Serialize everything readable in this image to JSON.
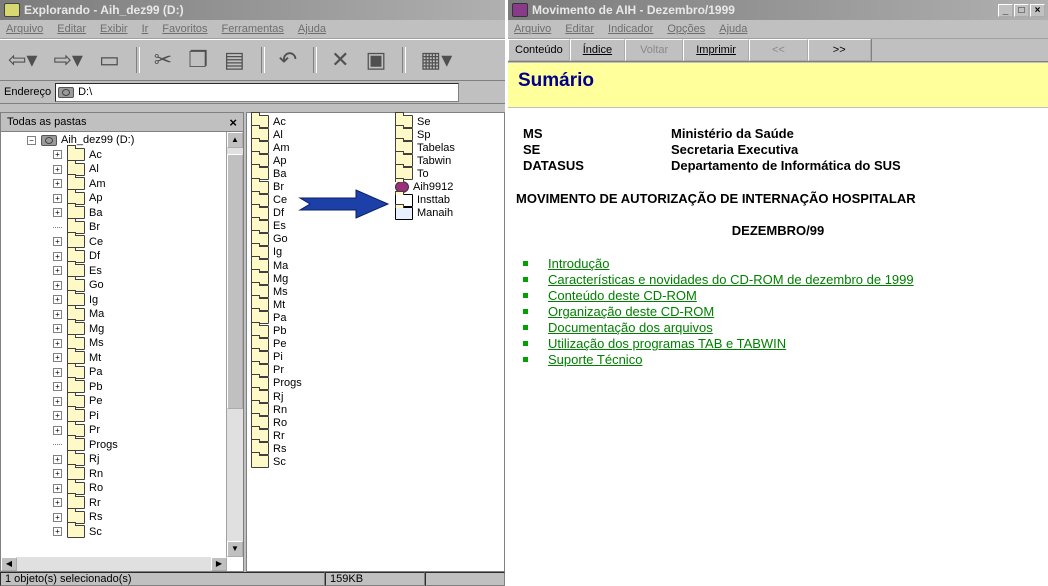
{
  "explorer": {
    "title": "Explorando - Aih_dez99 (D:)",
    "menu": [
      "Arquivo",
      "Editar",
      "Exibir",
      "Ir",
      "Favoritos",
      "Ferramentas",
      "Ajuda"
    ],
    "address_label": "Endereço",
    "address_value": "D:\\",
    "tree_header": "Todas as pastas",
    "tree_close": "×",
    "root": "Aih_dez99 (D:)",
    "tree_items": [
      "Ac",
      "Al",
      "Am",
      "Ap",
      "Ba",
      "Br",
      "Ce",
      "Df",
      "Es",
      "Go",
      "Ig",
      "Ma",
      "Mg",
      "Ms",
      "Mt",
      "Pa",
      "Pb",
      "Pe",
      "Pi",
      "Pr",
      "Progs",
      "Rj",
      "Rn",
      "Ro",
      "Rr",
      "Rs",
      "Sc"
    ],
    "list_col1": [
      "Ac",
      "Al",
      "Am",
      "Ap",
      "Ba",
      "Br",
      "Ce",
      "Df",
      "Es",
      "Go",
      "Ig",
      "Ma",
      "Mg",
      "Ms",
      "Mt",
      "Pa",
      "Pb",
      "Pe",
      "Pi",
      "Pr",
      "Progs",
      "Rj",
      "Rn",
      "Ro",
      "Rr",
      "Rs",
      "Sc"
    ],
    "list_col2_folders": [
      "Se",
      "Sp",
      "Tabelas",
      "Tabwin",
      "To"
    ],
    "list_col2_files": [
      "Aih9912",
      "Insttab",
      "Manaih"
    ],
    "status_left": "1 objeto(s) selecionado(s)",
    "status_size": "159KB"
  },
  "help": {
    "title": "Movimento de AIH - Dezembro/1999",
    "menu": [
      "Arquivo",
      "Editar",
      "Indicador",
      "Opções",
      "Ajuda"
    ],
    "buttons": [
      "Conteúdo",
      "Índice",
      "Voltar",
      "Imprimir",
      "<<",
      ">>"
    ],
    "heading": "Sumário",
    "org": [
      {
        "code": "MS",
        "name": "Ministério da Saúde"
      },
      {
        "code": "SE",
        "name": "Secretaria Executiva"
      },
      {
        "code": "DATASUS",
        "name": "Departamento de Informática do SUS"
      }
    ],
    "doc_title": "MOVIMENTO DE AUTORIZAÇÃO DE INTERNAÇÃO HOSPITALAR",
    "doc_date": "DEZEMBRO/99",
    "links": [
      "Introdução",
      "Características e novidades do CD-ROM de dezembro de 1999",
      "Conteúdo deste CD-ROM",
      "Organização deste CD-ROM",
      "Documentação dos arquivos",
      "Utilização dos programas TAB e TABWIN",
      "Suporte Técnico"
    ],
    "window_controls": [
      "_",
      "□",
      "×"
    ]
  },
  "colors": {
    "help_heading_bg": "#ffff9c",
    "link": "#008000",
    "arrow": "#1c3fa8"
  }
}
